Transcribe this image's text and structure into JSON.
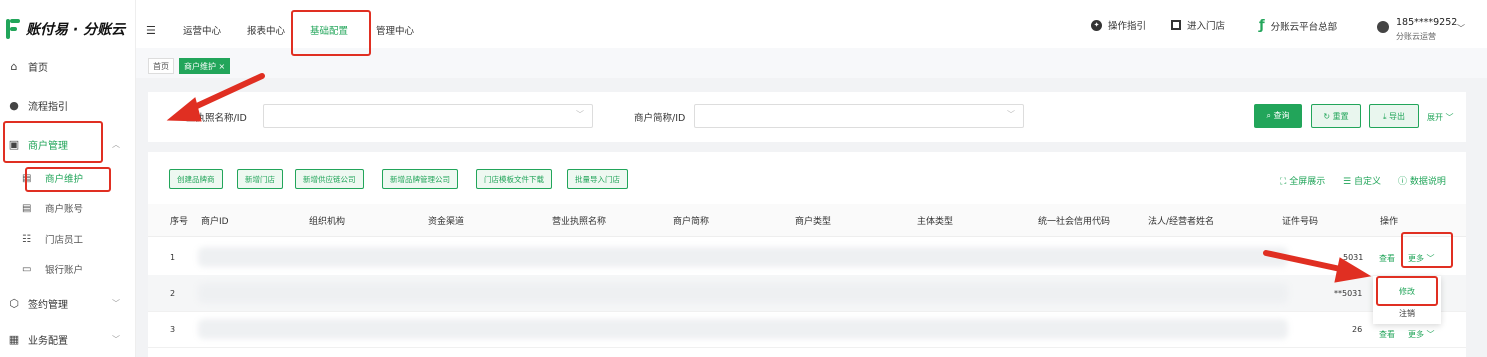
{
  "brand": {
    "name": "账付易 · 分账云"
  },
  "sidebar": {
    "items": [
      {
        "label": "首页",
        "icon": "home-icon"
      },
      {
        "label": "流程指引",
        "icon": "bulb-icon"
      },
      {
        "label": "商户管理",
        "icon": "merchant-icon",
        "expanded": true
      },
      {
        "label": "签约管理",
        "icon": "sign-icon"
      },
      {
        "label": "业务配置",
        "icon": "config-icon"
      }
    ],
    "sub_items": [
      {
        "label": "商户维护",
        "active": true
      },
      {
        "label": "商户账号"
      },
      {
        "label": "门店员工"
      },
      {
        "label": "银行账户"
      }
    ]
  },
  "topbar": {
    "tabs": [
      {
        "label": "运营中心"
      },
      {
        "label": "报表中心"
      },
      {
        "label": "基础配置",
        "active": true
      },
      {
        "label": "管理中心"
      }
    ],
    "guide": "操作指引",
    "enter_store": "进入门店",
    "platform": "分账云平台总部",
    "user_phone": "185****9252",
    "user_role": "分账云运营"
  },
  "breadcrumb": {
    "home": "首页",
    "current": "商户维护 ×"
  },
  "filter": {
    "license_label": "业执照名称/ID",
    "short_label": "商户简称/ID",
    "query": "查询",
    "reset": "重置",
    "export": "导出",
    "expand": "展开"
  },
  "actions": [
    "创建品牌商",
    "新增门店",
    "新增供应链公司",
    "新增品牌管理公司",
    "门店模板文件下载",
    "批量导入门店"
  ],
  "tools": {
    "fullscreen": "全屏展示",
    "custom": "自定义",
    "help": "数据说明"
  },
  "table": {
    "columns": [
      "序号",
      "商户ID",
      "组织机构",
      "资金渠道",
      "营业执照名称",
      "商户简称",
      "商户类型",
      "主体类型",
      "统一社会信用代码",
      "法人/经营者姓名",
      "证件号码",
      "操作"
    ],
    "rows": [
      {
        "index": "1",
        "id_tail": "5031",
        "view": "查看",
        "more": "更多"
      },
      {
        "index": "2",
        "id_tail": "**5031"
      },
      {
        "index": "3",
        "id_tail": "26",
        "view": "查看",
        "more": "更多"
      }
    ]
  },
  "more_menu": {
    "edit": "修改",
    "cancel": "注销"
  },
  "colors": {
    "accent": "#22a55a",
    "highlight": "#e02f22"
  }
}
